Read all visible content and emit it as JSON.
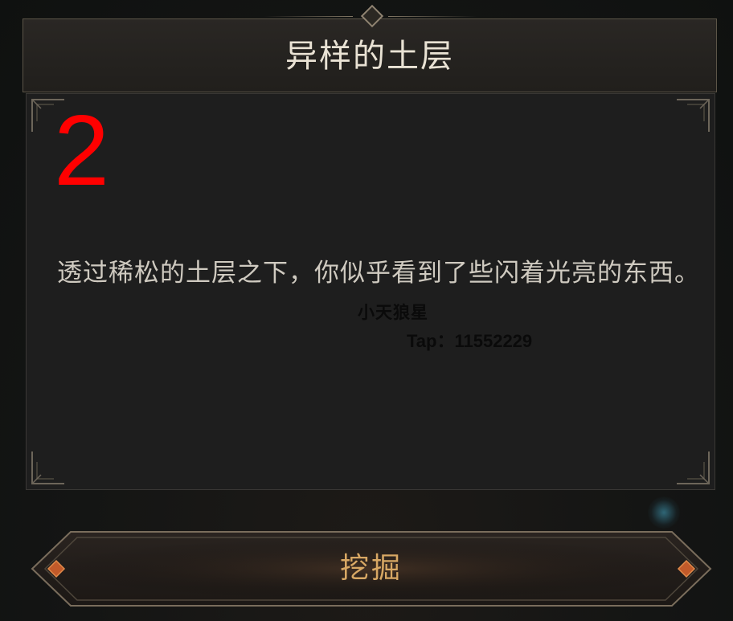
{
  "dialog": {
    "title": "异样的土层",
    "step_number": "2",
    "body_text": "透过稀松的土层之下，你似乎看到了些闪着光亮的东西。",
    "watermark_name": "小天狼星",
    "watermark_tap": "Tap：11552229"
  },
  "action": {
    "dig_label": "挖掘"
  },
  "colors": {
    "title_text": "#e9e2d4",
    "step_number": "#ff0000",
    "body_text": "#cfcac0",
    "button_text": "#d8a864",
    "button_gem": "#c25a2a"
  }
}
